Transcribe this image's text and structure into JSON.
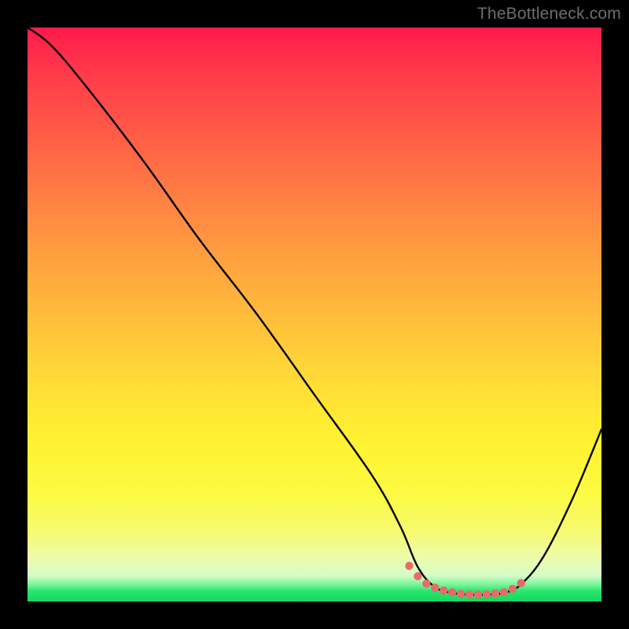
{
  "watermark": "TheBottleneck.com",
  "colors": {
    "frame": "#000000",
    "curve": "#000000",
    "dots": "#e86a6a",
    "gradient_top": "#ff1a4b",
    "gradient_bottom": "#14d85e"
  },
  "chart_data": {
    "type": "line",
    "title": "",
    "xlabel": "",
    "ylabel": "",
    "xlim": [
      0,
      100
    ],
    "ylim": [
      0,
      100
    ],
    "grid": false,
    "legend": false,
    "series": [
      {
        "name": "bottleneck-curve",
        "x": [
          0,
          4,
          10,
          20,
          30,
          40,
          50,
          60,
          65,
          68,
          71,
          74,
          77,
          80,
          83,
          86,
          90,
          95,
          100
        ],
        "y": [
          100,
          97,
          90,
          77,
          63,
          50,
          36,
          22,
          13,
          6,
          2.5,
          1.5,
          1.2,
          1.2,
          1.5,
          3,
          8,
          18,
          30
        ]
      }
    ],
    "highlight_dots": {
      "name": "optimal-range",
      "x": [
        66.5,
        68,
        69.5,
        71,
        72.5,
        74,
        75.5,
        77,
        78.5,
        80,
        81.5,
        83,
        84.5,
        86
      ],
      "y": [
        6.2,
        4.4,
        3.1,
        2.4,
        1.9,
        1.6,
        1.35,
        1.2,
        1.2,
        1.25,
        1.4,
        1.6,
        2.2,
        3.2
      ]
    }
  }
}
